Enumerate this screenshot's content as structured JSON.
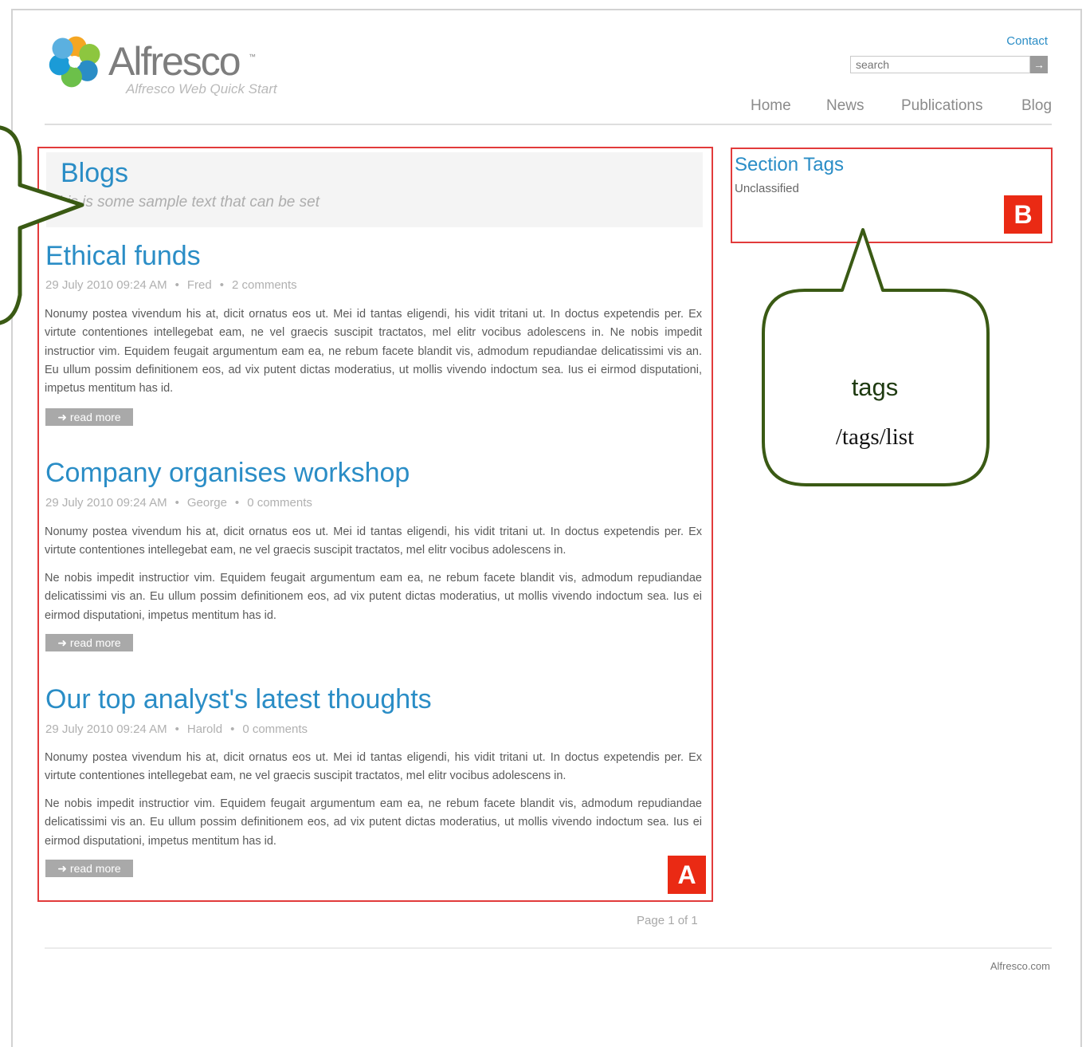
{
  "header": {
    "brand": "Alfresco",
    "brand_tm": "™",
    "tagline": "Alfresco Web Quick Start",
    "contact": "Contact",
    "search_placeholder": "search",
    "search_btn": "→",
    "nav": [
      "Home",
      "News",
      "Publications",
      "Blog"
    ]
  },
  "main": {
    "title": "Blogs",
    "description": "This is some sample text that can be set",
    "posts": [
      {
        "title": "Ethical funds",
        "date": "29 July 2010 09:24 AM",
        "author": "Fred",
        "comments": "2 comments",
        "paragraphs": [
          "Nonumy postea vivendum his at, dicit ornatus eos ut. Mei id tantas eligendi, his vidit tritani ut. In doctus expetendis per. Ex virtute contentiones intellegebat eam, ne vel graecis suscipit tractatos, mel elitr vocibus adolescens in. Ne nobis impedit instructior vim. Equidem feugait argumentum eam ea, ne rebum facete blandit vis, admodum repudiandae delicatissimi vis an. Eu ullum possim definitionem eos, ad vix putent dictas moderatius, ut mollis vivendo indoctum sea. Ius ei eirmod disputationi, impetus mentitum has id."
        ],
        "read_more": "➜ read more"
      },
      {
        "title": "Company organises workshop",
        "date": "29 July 2010 09:24 AM",
        "author": "George",
        "comments": "0 comments",
        "paragraphs": [
          "Nonumy postea vivendum his at, dicit ornatus eos ut. Mei id tantas eligendi, his vidit tritani ut. In doctus expetendis per. Ex virtute contentiones intellegebat eam, ne vel graecis suscipit tractatos, mel elitr vocibus adolescens in.",
          "Ne nobis impedit instructior vim. Equidem feugait argumentum eam ea, ne rebum facete blandit vis, admodum repudiandae delicatissimi vis an. Eu ullum possim definitionem eos, ad vix putent dictas moderatius, ut mollis vivendo indoctum sea. Ius ei eirmod disputationi, impetus mentitum has id."
        ],
        "read_more": "➜ read more"
      },
      {
        "title": "Our top analyst's latest thoughts",
        "date": "29 July 2010 09:24 AM",
        "author": "Harold",
        "comments": "0 comments",
        "paragraphs": [
          "Nonumy postea vivendum his at, dicit ornatus eos ut. Mei id tantas eligendi, his vidit tritani ut. In doctus expetendis per. Ex virtute contentiones intellegebat eam, ne vel graecis suscipit tractatos, mel elitr vocibus adolescens in.",
          "Ne nobis impedit instructior vim. Equidem feugait argumentum eam ea, ne rebum facete blandit vis, admodum repudiandae delicatissimi vis an. Eu ullum possim definitionem eos, ad vix putent dictas moderatius, ut mollis vivendo indoctum sea. Ius ei eirmod disputationi, impetus mentitum has id."
        ],
        "read_more": "➜ read more"
      }
    ],
    "pager": "Page 1 of 1",
    "badge": "A"
  },
  "sidebar": {
    "title": "Section Tags",
    "tags": [
      "Unclassified"
    ],
    "badge": "B"
  },
  "callout": {
    "label": "tags",
    "path": "/tags/list"
  },
  "footer": {
    "link": "Alfresco.com"
  },
  "colors": {
    "link_blue": "#2a8dc6",
    "annotation_red": "#e23b3b",
    "badge_red": "#ea2a14",
    "callout_green": "#3a5a14"
  }
}
